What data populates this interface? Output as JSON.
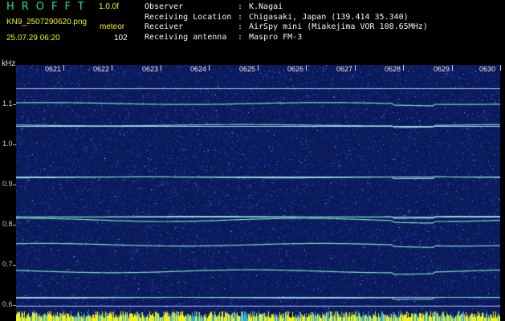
{
  "header": {
    "logo": "HROFFT",
    "version": "1.0.0f",
    "filename": "KN9_2507290620.png",
    "mode": "meteor",
    "datetime": "25.07.29 06:20",
    "count": "102"
  },
  "station": [
    {
      "key": "Observer",
      "value": "K.Nagai"
    },
    {
      "key": "Receiving Location",
      "value": "Chigasaki, Japan (139.414 35.340)"
    },
    {
      "key": "Receiver",
      "value": "AirSpy mini (Miakejima VOR 108.65MHz)"
    },
    {
      "key": "Receiving antenna",
      "value": "Maspro FM-3"
    }
  ],
  "axis": {
    "unit": "kHz",
    "y_labels": [
      "1.1",
      "1.0",
      "0.9",
      "0.8",
      "0.7",
      "0.6"
    ],
    "time_labels": [
      "0621",
      "0622",
      "0623",
      "0624",
      "0625",
      "0626",
      "0627",
      "0628",
      "0629",
      "0630"
    ]
  },
  "colors": {
    "background": "#0a1a5a",
    "noise": "#3a60e0",
    "line": "#7fe0c0",
    "logo": "#27e27a",
    "label": "#f2f21a"
  }
}
